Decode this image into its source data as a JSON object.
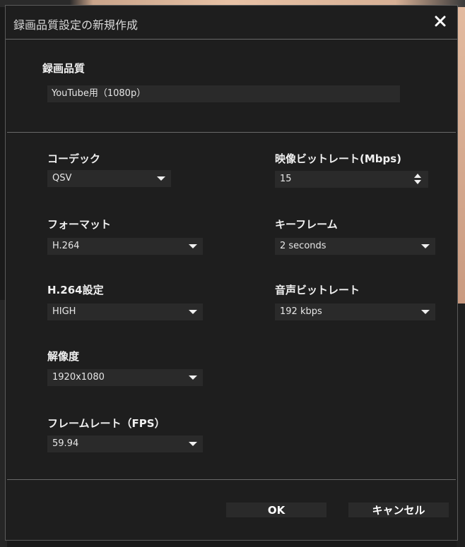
{
  "dialog": {
    "title": "録画品質設定の新規作成",
    "close_icon": "close-icon"
  },
  "quality": {
    "label": "録画品質",
    "value": "YouTube用（1080p）"
  },
  "left": {
    "codec": {
      "label": "コーデック",
      "value": "QSV"
    },
    "format": {
      "label": "フォーマット",
      "value": "H.264"
    },
    "h264": {
      "label": "H.264設定",
      "value": "HIGH"
    },
    "resolution": {
      "label": "解像度",
      "value": "1920x1080"
    },
    "framerate": {
      "label": "フレームレート（FPS）",
      "value": "59.94"
    }
  },
  "right": {
    "video_bitrate": {
      "label": "映像ビットレート(Mbps)",
      "value": "15"
    },
    "keyframe": {
      "label": "キーフレーム",
      "value": "2 seconds"
    },
    "audio_bitrate": {
      "label": "音声ビットレート",
      "value": "192 kbps"
    }
  },
  "buttons": {
    "ok": "OK",
    "cancel": "キャンセル"
  },
  "colors": {
    "dialog_bg": "#1e1e1e",
    "field_bg": "#2a2a2a",
    "border": "#6a6a6a",
    "text": "#e6e6e6"
  }
}
